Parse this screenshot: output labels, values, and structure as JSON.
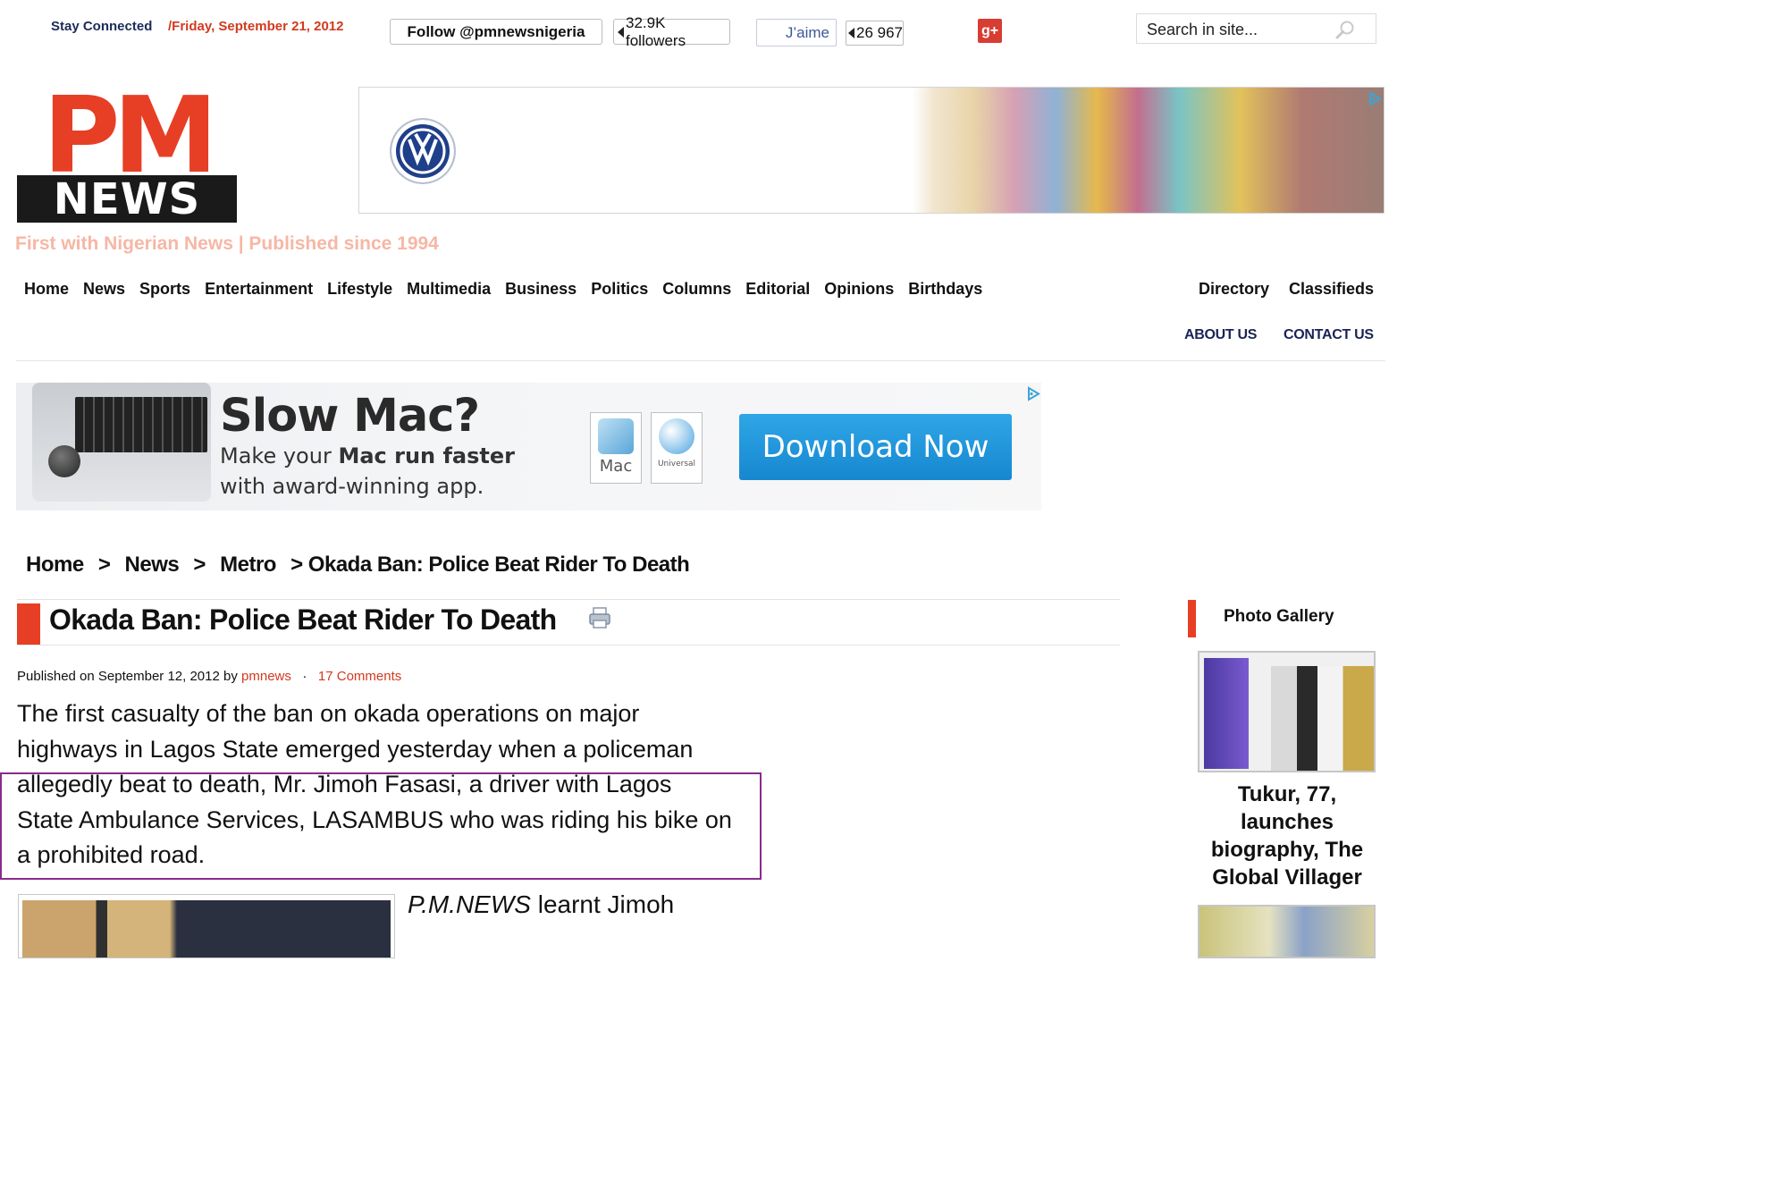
{
  "topbar": {
    "stay_connected": "Stay Connected",
    "date": "/Friday, September 21, 2012",
    "twitter_follow": "Follow @pmnewsnigeria",
    "twitter_followers": "32.9K followers",
    "facebook_like": "J’aime",
    "facebook_count": "26 967",
    "gplus_label": "g+",
    "search_placeholder": "Search in site..."
  },
  "logo": {
    "pm": "PM",
    "news": "NEWS",
    "tagline": "First with Nigerian News | Published since 1994"
  },
  "nav": {
    "items": [
      "Home",
      "News",
      "Sports",
      "Entertainment",
      "Lifestyle",
      "Multimedia",
      "Business",
      "Politics",
      "Columns",
      "Editorial",
      "Opinions",
      "Birthdays"
    ],
    "directory": "Directory",
    "classifieds": "Classifieds",
    "about": "ABOUT US",
    "contact": "CONTACT US"
  },
  "mac_ad": {
    "headline": "Slow Mac?",
    "sub_prefix": "Make your ",
    "sub_bold": "Mac run faster",
    "sub_suffix": " with award-winning app.",
    "badge_mac": "Mac",
    "badge_universal": "Universal",
    "cta": "Download Now"
  },
  "breadcrumb": {
    "home": "Home",
    "sep": ">",
    "news": "News",
    "metro": "Metro",
    "current": "> Okada Ban: Police Beat Rider To Death"
  },
  "article": {
    "title": "Okada Ban: Police Beat Rider To Death",
    "meta_prefix": "Published on September 12, 2012 by ",
    "author": "pmnews",
    "meta_dot": "·",
    "comments": "17 Comments",
    "lead": "The first casualty of the ban on okada operations on major highways in Lagos State emerged yesterday when a policeman allegedly beat to death, Mr. Jimoh Fasasi, a driver with Lagos State Ambulance Services, LASAMBUS who was riding his bike on a prohibited road.",
    "next_italic": "P.M.NEWS",
    "next_text": " learnt Jimoh"
  },
  "sidebar": {
    "gallery_title": "Photo Gallery",
    "caption": "Tukur, 77, launches biography, The Global Villager"
  },
  "colors": {
    "brand_red": "#e73f25",
    "navy": "#1a2355",
    "highlight": "#8a2a8c"
  }
}
